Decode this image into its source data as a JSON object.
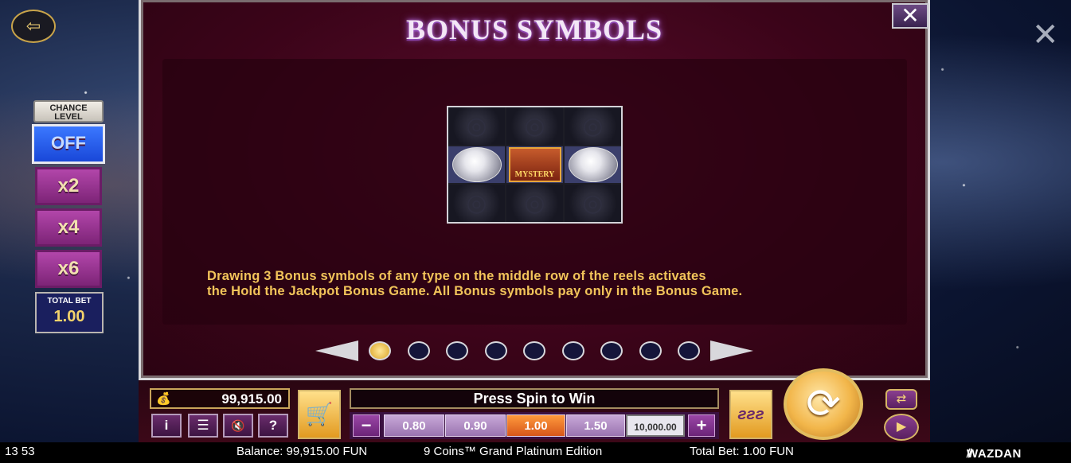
{
  "top": {
    "exit_icon": "exit-icon",
    "close_icon": "close-icon"
  },
  "chance": {
    "title_line1": "CHANCE",
    "title_line2": "LEVEL",
    "options": [
      "OFF",
      "x2",
      "x4",
      "x6"
    ],
    "total_bet_label": "TOTAL BET",
    "total_bet_value": "1.00"
  },
  "panel": {
    "title": "BONUS SYMBOLS",
    "close": "✕",
    "description_line1": "Drawing 3 Bonus symbols of any type on the middle row of the reels activates",
    "description_line2": "the Hold the Jackpot Bonus Game. All Bonus symbols pay only in the Bonus Game.",
    "mystery_label": "MYSTERY",
    "page_count": 9,
    "active_page": 1
  },
  "controls": {
    "balance_value": "99,915.00",
    "message": "Press Spin to Win",
    "bet_values": [
      "0.80",
      "0.90",
      "1.00",
      "1.50",
      "10,000.00"
    ],
    "selected_bet": "1.00",
    "minus": "−",
    "plus": "+",
    "info": "i",
    "menu": "☰",
    "sound": "🔇",
    "help": "?"
  },
  "status": {
    "time": "13 53",
    "balance": "Balance: 99,915.00 FUN",
    "game_title": "9 Coins™ Grand Platinum Edition",
    "total_bet": "Total Bet: 1.00 FUN",
    "brand": "WAZDAN"
  }
}
